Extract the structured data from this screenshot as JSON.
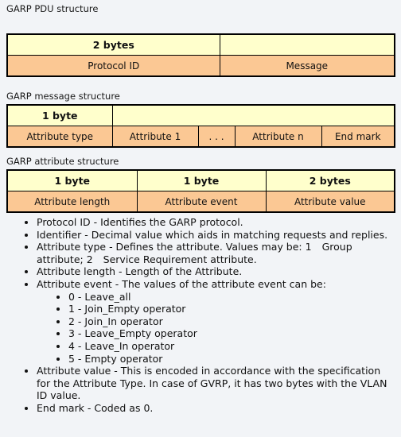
{
  "sections": [
    {
      "heading": "GARP PDU structure",
      "table": {
        "size_row": [
          "2 bytes",
          ""
        ],
        "field_row": [
          "Protocol ID",
          "Message"
        ]
      }
    },
    {
      "heading": "GARP message structure",
      "table": {
        "size_row": [
          "1 byte",
          ""
        ],
        "field_row": [
          "Attribute type",
          "Attribute 1",
          ". . .",
          "Attribute n",
          "End mark"
        ]
      }
    },
    {
      "heading": "GARP attribute structure",
      "table": {
        "size_row": [
          "1 byte",
          "1 byte",
          "2 bytes"
        ],
        "field_row": [
          "Attribute length",
          "Attribute event",
          "Attribute value"
        ]
      }
    }
  ],
  "notes": {
    "items": [
      {
        "text": "Protocol ID - Identifies the GARP protocol."
      },
      {
        "text": "Identifier - Decimal value which aids in matching requests and replies."
      },
      {
        "text_parts": [
          "Attribute type - Defines the attribute. Values may be:  1",
          "Group attribute; 2",
          "Service Requirement attribute."
        ]
      },
      {
        "text": "Attribute length - Length of the Attribute."
      },
      {
        "text": "Attribute event - The values of the attribute event can be:",
        "sub_items": [
          "0 - Leave_all",
          "1 - Join_Empty operator",
          "2 - Join_In operator",
          "3 - Leave_Empty operator",
          "4 - Leave_In operator",
          "5 - Empty operator"
        ]
      },
      {
        "text": "Attribute value - This is encoded in accordance with the specification for the Attribute Type. In case of GVRP, it has two bytes with the VLAN ID value."
      },
      {
        "text": "End mark - Coded as 0."
      }
    ]
  },
  "colors": {
    "page_background": "#f2f4f7",
    "size_row_fill": "#ffffcc",
    "field_row_fill": "#fbc894",
    "border": "#000000",
    "text": "#111111"
  }
}
